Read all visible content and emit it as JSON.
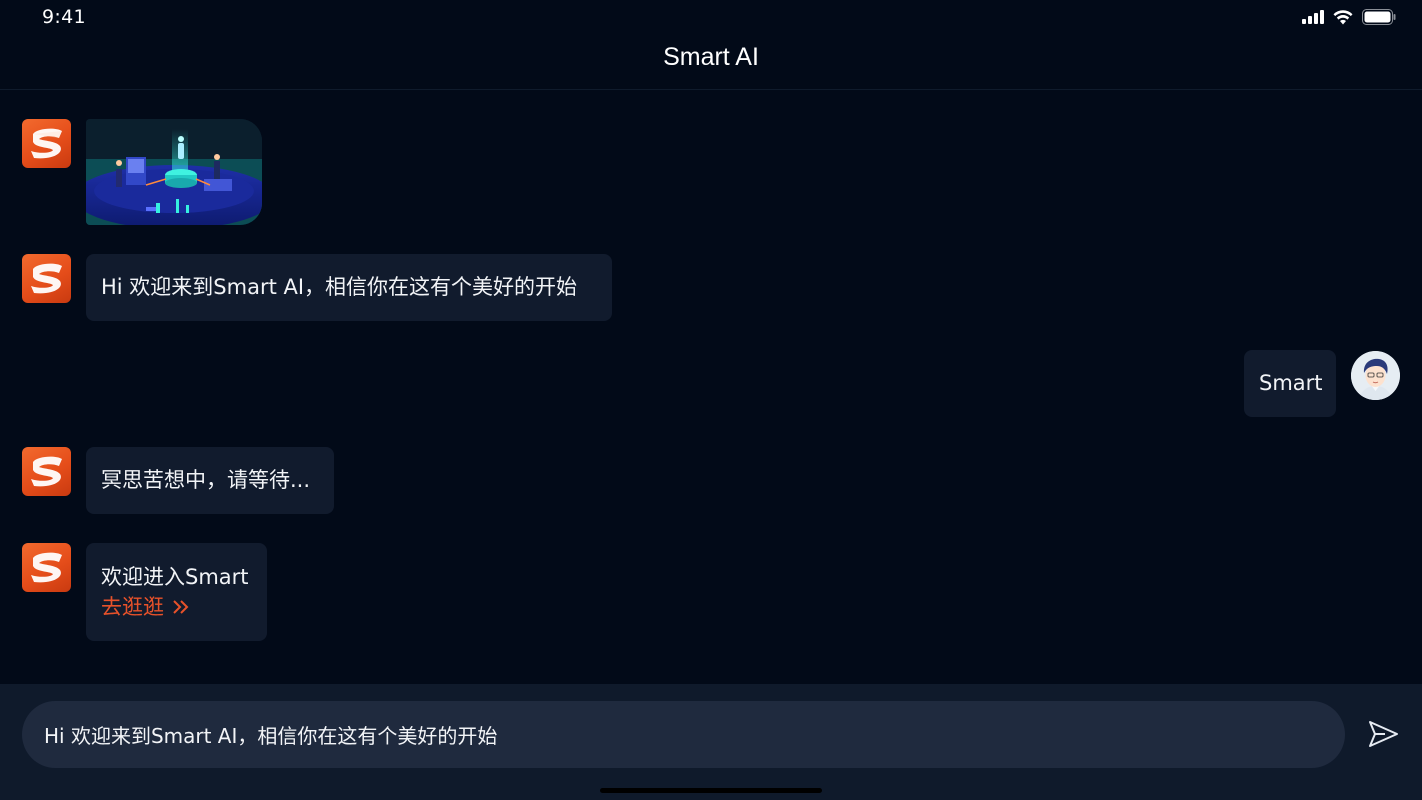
{
  "status_bar": {
    "time": "9:41",
    "icons": [
      "signal-icon",
      "wifi-icon",
      "battery-icon"
    ]
  },
  "nav": {
    "title": "Smart AI"
  },
  "messages": [
    {
      "sender": "bot",
      "type": "image",
      "image_desc_icon": "illustration-image"
    },
    {
      "sender": "bot",
      "type": "text",
      "text": "Hi 欢迎来到Smart AI，相信你在这有个美好的开始"
    },
    {
      "sender": "user",
      "type": "text",
      "text": "Smart"
    },
    {
      "sender": "bot",
      "type": "text",
      "text": "冥思苦想中，请等待..."
    },
    {
      "sender": "bot",
      "type": "link",
      "text": "欢迎进入Smart",
      "link_text": "去逛逛"
    }
  ],
  "input": {
    "value": "Hi 欢迎来到Smart AI，相信你在这有个美好的开始",
    "send_icon": "send-icon"
  },
  "colors": {
    "background": "#020a18",
    "bubble": "#111b2d",
    "accent": "#e8522a",
    "input_bar": "#0f1a2b",
    "input_field": "#1f2a3e"
  }
}
